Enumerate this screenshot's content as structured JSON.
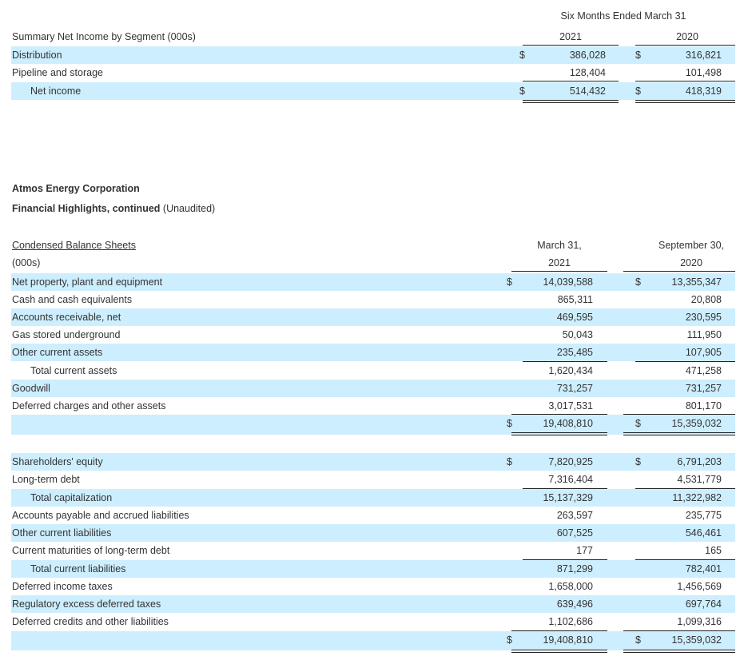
{
  "segment": {
    "period_header": "Six Months Ended March 31",
    "col1": "2021",
    "col2": "2020",
    "title": "Summary Net Income by Segment (000s)",
    "rows": [
      {
        "label": "Distribution",
        "d1": "$",
        "v1": "386,028",
        "d2": "$",
        "v2": "316,821"
      },
      {
        "label": "Pipeline and storage",
        "d1": "",
        "v1": "128,404",
        "d2": "",
        "v2": "101,498"
      },
      {
        "label": "Net income",
        "d1": "$",
        "v1": "514,432",
        "d2": "$",
        "v2": "418,319"
      }
    ]
  },
  "company": {
    "name": "Atmos Energy Corporation",
    "subtitle_bold": "Financial Highlights, continued",
    "subtitle_normal": "(Unaudited)"
  },
  "balance": {
    "title": "Condensed Balance Sheets",
    "units": "(000s)",
    "col1_line1": "March 31,",
    "col1_line2": "2021",
    "col2_line1": "September 30,",
    "col2_line2": "2020",
    "assets": [
      {
        "label": "Net property, plant and equipment",
        "d1": "$",
        "v1": "14,039,588",
        "d2": "$",
        "v2": "13,355,347"
      },
      {
        "label": "Cash and cash equivalents",
        "d1": "",
        "v1": "865,311",
        "d2": "",
        "v2": "20,808"
      },
      {
        "label": "Accounts receivable, net",
        "d1": "",
        "v1": "469,595",
        "d2": "",
        "v2": "230,595"
      },
      {
        "label": "Gas stored underground",
        "d1": "",
        "v1": "50,043",
        "d2": "",
        "v2": "111,950"
      },
      {
        "label": "Other current assets",
        "d1": "",
        "v1": "235,485",
        "d2": "",
        "v2": "107,905"
      },
      {
        "label": "Total current assets",
        "d1": "",
        "v1": "1,620,434",
        "d2": "",
        "v2": "471,258"
      },
      {
        "label": "Goodwill",
        "d1": "",
        "v1": "731,257",
        "d2": "",
        "v2": "731,257"
      },
      {
        "label": "Deferred charges and other assets",
        "d1": "",
        "v1": "3,017,531",
        "d2": "",
        "v2": "801,170"
      },
      {
        "label": "",
        "d1": "$",
        "v1": "19,408,810",
        "d2": "$",
        "v2": "15,359,032"
      }
    ],
    "liabilities": [
      {
        "label": "Shareholders' equity",
        "d1": "$",
        "v1": "7,820,925",
        "d2": "$",
        "v2": "6,791,203"
      },
      {
        "label": "Long-term debt",
        "d1": "",
        "v1": "7,316,404",
        "d2": "",
        "v2": "4,531,779"
      },
      {
        "label": "Total capitalization",
        "d1": "",
        "v1": "15,137,329",
        "d2": "",
        "v2": "11,322,982"
      },
      {
        "label": "Accounts payable and accrued liabilities",
        "d1": "",
        "v1": "263,597",
        "d2": "",
        "v2": "235,775"
      },
      {
        "label": "Other current liabilities",
        "d1": "",
        "v1": "607,525",
        "d2": "",
        "v2": "546,461"
      },
      {
        "label": "Current maturities of long-term debt",
        "d1": "",
        "v1": "177",
        "d2": "",
        "v2": "165"
      },
      {
        "label": "Total current liabilities",
        "d1": "",
        "v1": "871,299",
        "d2": "",
        "v2": "782,401"
      },
      {
        "label": "Deferred income taxes",
        "d1": "",
        "v1": "1,658,000",
        "d2": "",
        "v2": "1,456,569"
      },
      {
        "label": "Regulatory excess deferred taxes",
        "d1": "",
        "v1": "639,496",
        "d2": "",
        "v2": "697,764"
      },
      {
        "label": "Deferred credits and other liabilities",
        "d1": "",
        "v1": "1,102,686",
        "d2": "",
        "v2": "1,099,316"
      },
      {
        "label": "",
        "d1": "$",
        "v1": "19,408,810",
        "d2": "$",
        "v2": "15,359,032"
      }
    ]
  }
}
